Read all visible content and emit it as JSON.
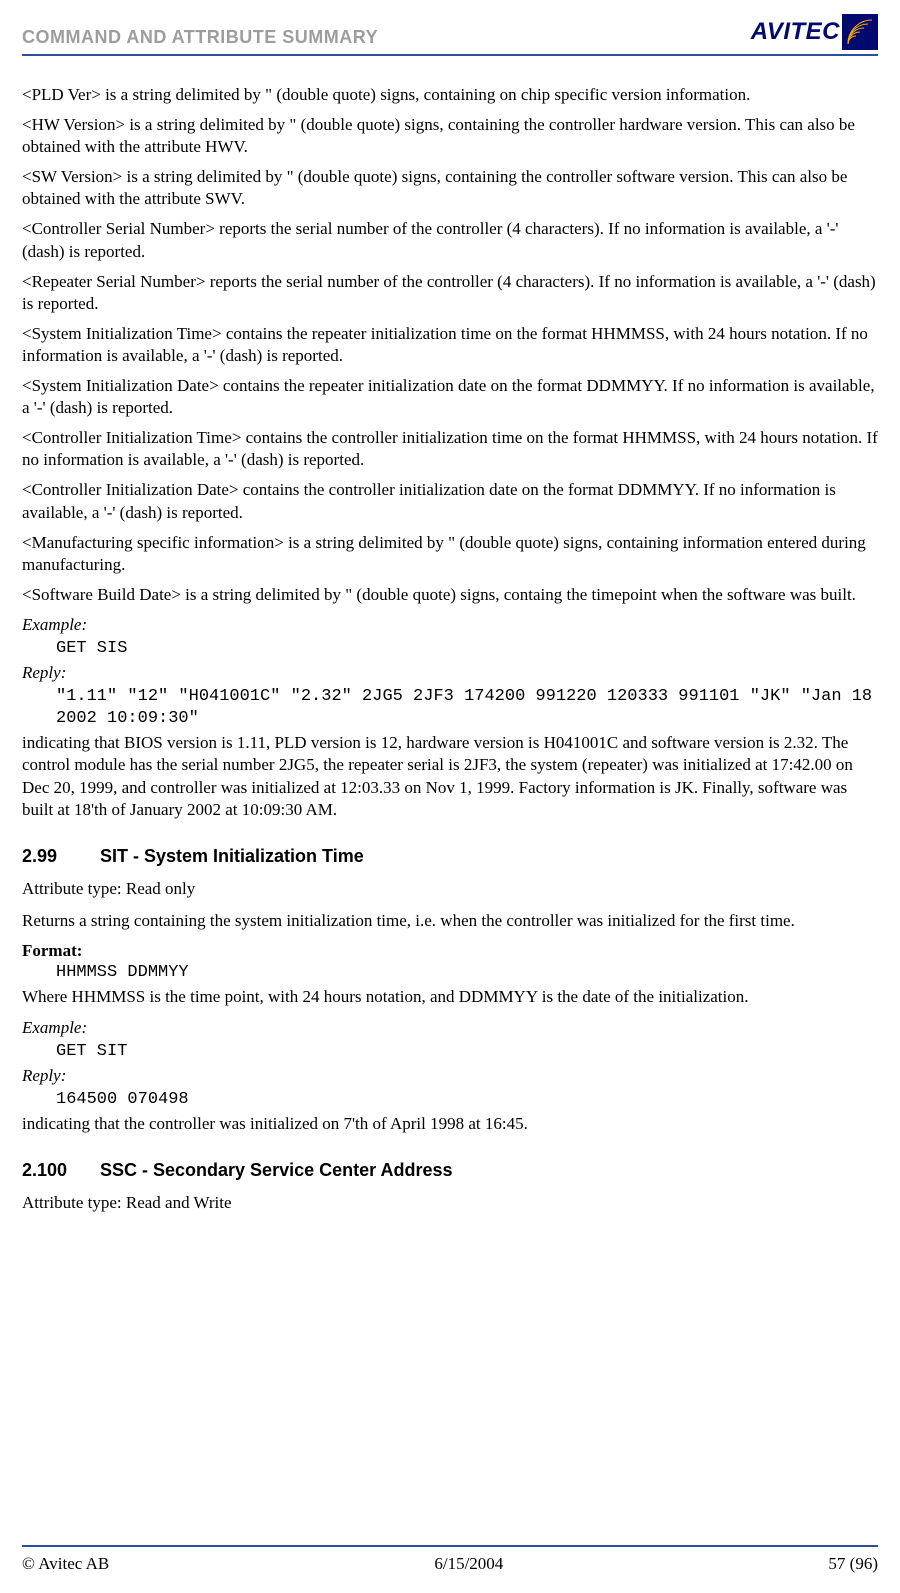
{
  "header": {
    "title": "COMMAND AND ATTRIBUTE SUMMARY",
    "logo": {
      "text": "AVITEC",
      "icon_name": "avitec-sun-icon"
    }
  },
  "body": {
    "p1": "<PLD Ver> is a string delimited by \" (double quote) signs, containing on chip specific version information.",
    "p2": "<HW Version> is a string delimited by \" (double quote) signs, containing the controller hardware version. This can also be obtained with the attribute HWV.",
    "p3": "<SW Version> is a string delimited by \" (double quote) signs, containing the controller software version. This can also be obtained with the attribute SWV.",
    "p4": "<Controller Serial Number> reports the serial number of the controller (4 characters). If no information is available, a '-' (dash) is reported.",
    "p5": "<Repeater Serial Number> reports the serial number of the controller (4 characters). If no information is available, a '-' (dash) is reported.",
    "p6": "<System Initialization Time> contains the repeater initialization time on the format HHMMSS, with 24 hours notation. If no information is available, a '-' (dash) is reported.",
    "p7": "<System Initialization Date> contains the repeater initialization date on the format DDMMYY. If no information is available, a '-' (dash) is reported.",
    "p8": "<Controller Initialization Time> contains the controller initialization time on the format HHMMSS, with 24 hours notation. If no information is available, a '-' (dash) is reported.",
    "p9": "<Controller Initialization Date> contains the controller initialization date on the format DDMMYY. If no information is available, a '-' (dash) is reported.",
    "p10": "<Manufacturing specific information> is a string delimited by \" (double quote) signs,  containing information entered during manufacturing.",
    "p11": "<Software Build Date> is a string delimited by \" (double quote) signs,  containg the timepoint when the software was built.",
    "example1": {
      "label": "Example:",
      "code": "GET SIS"
    },
    "reply1": {
      "label": "Reply:",
      "code": "\"1.11\" \"12\" \"H041001C\" \"2.32\" 2JG5 2JF3 174200 991220 120333 991101 \"JK\" \"Jan 18 2002 10:09:30\""
    },
    "p12": "indicating that BIOS version is 1.11, PLD version is 12, hardware version is H041001C and software version is 2.32. The control module has the serial number 2JG5, the repeater serial is 2JF3, the system (repeater) was initialized at 17:42.00 on Dec 20, 1999, and controller was initialized at 12:03.33 on Nov 1, 1999. Factory information is JK. Finally, software was built at 18'th of January 2002 at 10:09:30 AM."
  },
  "section299": {
    "num": "2.99",
    "title": "SIT - System Initialization Time",
    "attr_type": "Attribute type: Read only",
    "desc": "Returns a string containing the system initialization time, i.e. when the controller was initialized for the first time.",
    "format_label": "Format:",
    "format_code": "HHMMSS DDMMYY",
    "format_desc": "Where HHMMSS is the time point, with 24 hours notation, and DDMMYY is the date of the initialization.",
    "example": {
      "label": "Example:",
      "code": "GET SIT"
    },
    "reply": {
      "label": "Reply:",
      "code": "164500 070498"
    },
    "result": "indicating that the controller was initialized on 7'th of April 1998 at 16:45."
  },
  "section2100": {
    "num": "2.100",
    "title": "SSC - Secondary Service Center Address",
    "attr_type": "Attribute type: Read and Write"
  },
  "footer": {
    "left": "© Avitec AB",
    "center": "6/15/2004",
    "right": "57 (96)"
  }
}
